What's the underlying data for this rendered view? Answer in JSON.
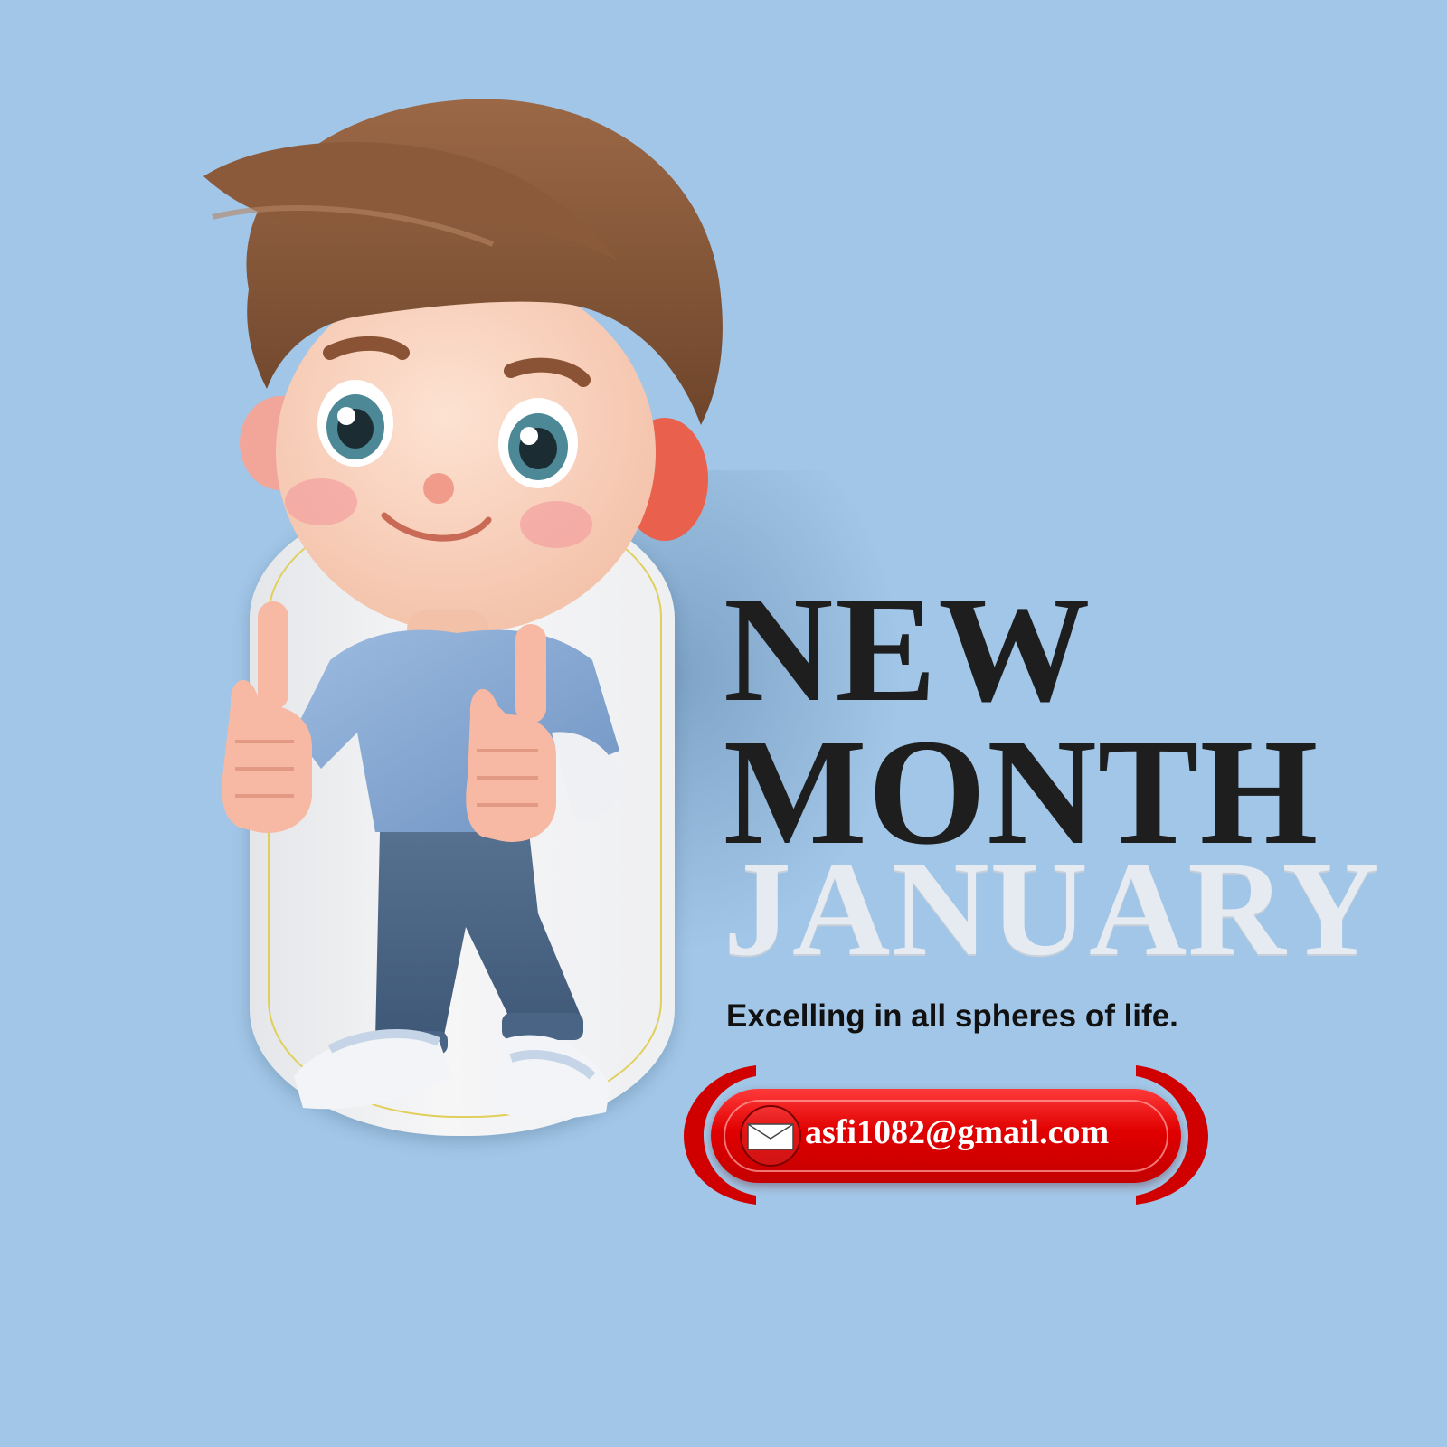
{
  "headline": {
    "line1": "NEW",
    "line2": "MONTH",
    "line3": "JANUARY"
  },
  "tagline": "Excelling in all spheres of life.",
  "contact": {
    "email": "asfi1082@gmail.com",
    "icon": "envelope-icon"
  },
  "colors": {
    "background": "#a2c6e7",
    "headline_dark": "#1e1e1e",
    "headline_light": "#e6ebf1",
    "banner_red": "#e00000"
  }
}
